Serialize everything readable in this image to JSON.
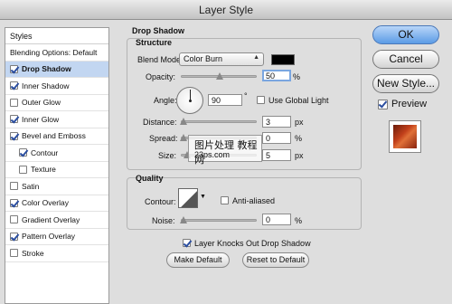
{
  "window": {
    "title": "Layer Style"
  },
  "styles_panel": {
    "header": "Styles",
    "items": [
      {
        "label": "Blending Options: Default",
        "checkbox": false,
        "checked": false,
        "selected": false,
        "indent": false
      },
      {
        "label": "Drop Shadow",
        "checkbox": true,
        "checked": true,
        "selected": true,
        "indent": false
      },
      {
        "label": "Inner Shadow",
        "checkbox": true,
        "checked": true,
        "selected": false,
        "indent": false
      },
      {
        "label": "Outer Glow",
        "checkbox": true,
        "checked": false,
        "selected": false,
        "indent": false
      },
      {
        "label": "Inner Glow",
        "checkbox": true,
        "checked": true,
        "selected": false,
        "indent": false
      },
      {
        "label": "Bevel and Emboss",
        "checkbox": true,
        "checked": true,
        "selected": false,
        "indent": false
      },
      {
        "label": "Contour",
        "checkbox": true,
        "checked": true,
        "selected": false,
        "indent": true
      },
      {
        "label": "Texture",
        "checkbox": true,
        "checked": false,
        "selected": false,
        "indent": true
      },
      {
        "label": "Satin",
        "checkbox": true,
        "checked": false,
        "selected": false,
        "indent": false
      },
      {
        "label": "Color Overlay",
        "checkbox": true,
        "checked": true,
        "selected": false,
        "indent": false
      },
      {
        "label": "Gradient Overlay",
        "checkbox": true,
        "checked": false,
        "selected": false,
        "indent": false
      },
      {
        "label": "Pattern Overlay",
        "checkbox": true,
        "checked": true,
        "selected": false,
        "indent": false
      },
      {
        "label": "Stroke",
        "checkbox": true,
        "checked": false,
        "selected": false,
        "indent": false
      }
    ]
  },
  "drop_shadow": {
    "section_title": "Drop Shadow",
    "structure": {
      "title": "Structure",
      "blend_mode_label": "Blend Mode:",
      "blend_mode_value": "Color Burn",
      "blend_color": "#000000",
      "opacity_label": "Opacity:",
      "opacity_value": "50",
      "opacity_unit": "%",
      "angle_label": "Angle:",
      "angle_value": "90",
      "angle_unit": "°",
      "global_light_label": "Use Global Light",
      "global_light_checked": false,
      "distance_label": "Distance:",
      "distance_value": "3",
      "distance_unit": "px",
      "spread_label": "Spread:",
      "spread_value": "0",
      "spread_unit": "%",
      "size_label": "Size:",
      "size_value": "5",
      "size_unit": "px"
    },
    "quality": {
      "title": "Quality",
      "contour_label": "Contour:",
      "anti_aliased_label": "Anti-aliased",
      "anti_aliased_checked": false,
      "noise_label": "Noise:",
      "noise_value": "0",
      "noise_unit": "%"
    },
    "knockout_label": "Layer Knocks Out Drop Shadow",
    "knockout_checked": true,
    "make_default_label": "Make Default",
    "reset_default_label": "Reset to Default"
  },
  "side_buttons": {
    "ok": "OK",
    "cancel": "Cancel",
    "new_style": "New Style...",
    "preview_label": "Preview",
    "preview_checked": true
  },
  "watermark": {
    "line1": "图片处理 教程网",
    "line2": "23ps.com"
  },
  "icons": {
    "check": "checkmark-icon",
    "dropdown": "dropdown-arrow-icon",
    "slider": "slider-thumb-icon",
    "angle": "angle-dial-icon",
    "contour": "contour-curve-icon"
  }
}
